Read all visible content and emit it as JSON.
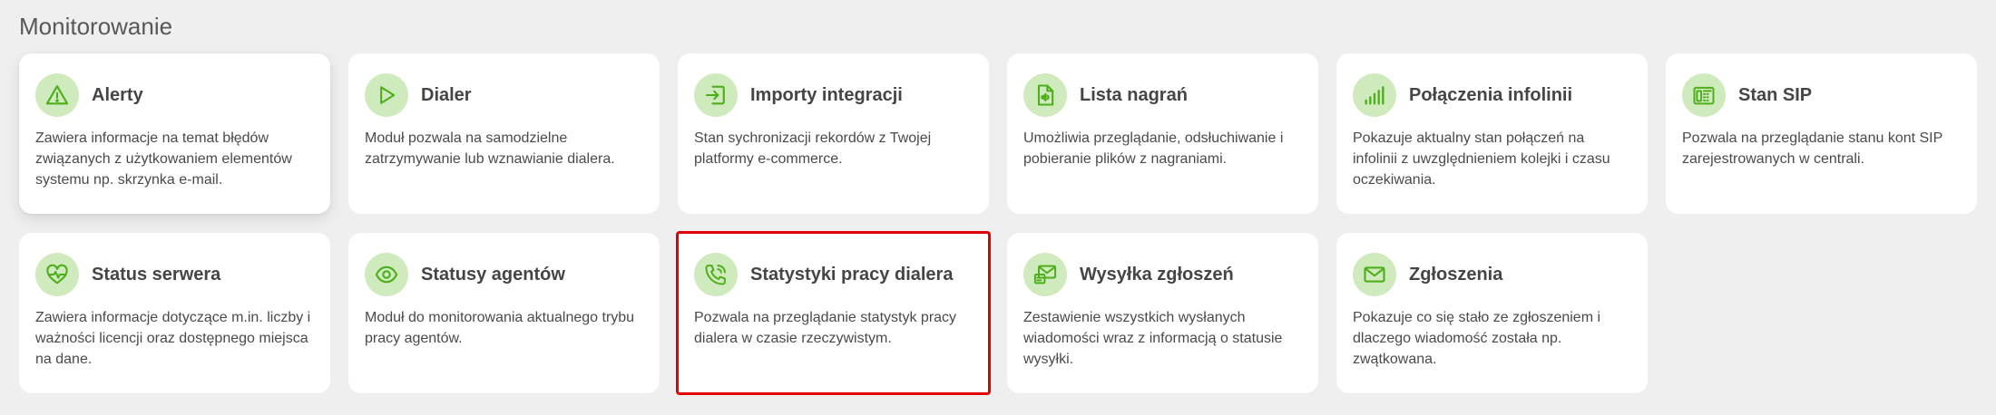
{
  "section": {
    "title": "Monitorowanie"
  },
  "colors": {
    "icon_bg": "#cfeabd",
    "icon_stroke": "#4caf1a",
    "highlight": "#e00000"
  },
  "cards": [
    {
      "title": "Alerty",
      "description": "Zawiera informacje na temat błędów związanych z użytkowaniem elementów systemu np. skrzynka e-mail.",
      "icon": "warning-triangle-icon"
    },
    {
      "title": "Dialer",
      "description": "Moduł pozwala na samodzielne zatrzymywanie lub wznawianie dialera.",
      "icon": "play-icon"
    },
    {
      "title": "Importy integracji",
      "description": "Stan sychronizacji rekordów z Twojej platformy e-commerce.",
      "icon": "import-icon"
    },
    {
      "title": "Lista nagrań",
      "description": "Umożliwia przeglądanie, odsłuchiwanie i pobieranie plików z nagraniami.",
      "icon": "audio-file-icon"
    },
    {
      "title": "Połączenia infolinii",
      "description": "Pokazuje aktualny stan połączeń na infolinii z uwzględnieniem kolejki i czasu oczekiwania.",
      "icon": "signal-bars-icon"
    },
    {
      "title": "Stan SIP",
      "description": "Pozwala na przeglądanie stanu kont SIP zarejestrowanych w centrali.",
      "icon": "fax-icon"
    },
    {
      "title": "Status serwera",
      "description": "Zawiera informacje dotyczące m.in. liczby i ważności licencji oraz dostępnego miejsca na dane.",
      "icon": "heart-pulse-icon"
    },
    {
      "title": "Statusy agentów",
      "description": "Moduł do monitorowania aktualnego trybu pracy agentów.",
      "icon": "eye-icon"
    },
    {
      "title": "Statystyki pracy dialera",
      "description": "Pozwala na przeglądanie statystyk pracy dialera w czasie rzeczywistym.",
      "icon": "phone-call-icon"
    },
    {
      "title": "Wysyłka zgłoszeń",
      "description": "Zestawienie wszystkich wysłanych wiadomości wraz z informacją o statusie wysyłki.",
      "icon": "mail-send-icon"
    },
    {
      "title": "Zgłoszenia",
      "description": "Pokazuje co się stało ze zgłoszeniem i dlaczego wiadomość została np. zwątkowana.",
      "icon": "envelope-icon"
    }
  ]
}
